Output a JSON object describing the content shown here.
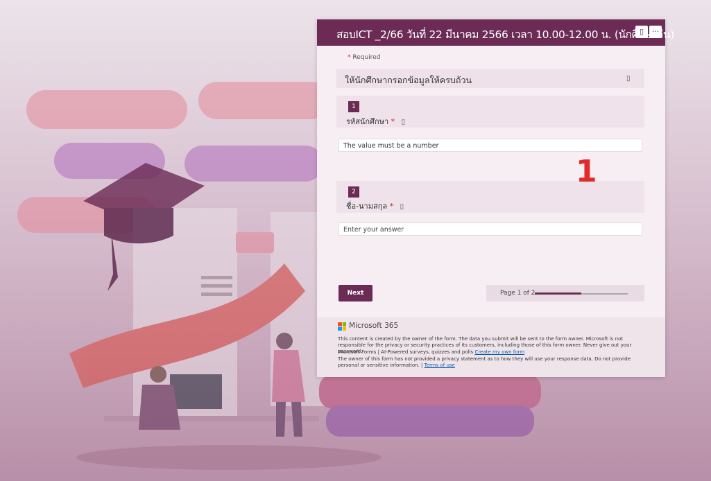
{
  "form": {
    "title": "สอบICT _2/66 วันที่ 22 มีนาคม 2566 เวลา 10.00-12.00 น. (นักศึกษาจีน)",
    "header_reader_label": "▯",
    "header_more_label": "···",
    "required_asterisk": "*",
    "required_label": "Required",
    "section_text": "ให้นักศึกษากรอกข้อมูลให้ครบถ้วน",
    "questions": [
      {
        "number": "1",
        "label": "รหัสนักศึกษา",
        "asterisk": "*",
        "answer": "The value must be a number"
      },
      {
        "number": "2",
        "label": "ชื่อ-นามสกุล",
        "asterisk": "*",
        "placeholder": "Enter your answer"
      }
    ],
    "next_label": "Next",
    "page_text": "Page 1 of 2",
    "page_progress_percent": 50
  },
  "footer": {
    "brand": "Microsoft 365",
    "line1": "This content is created by the owner of the form. The data you submit will be sent to the form owner. Microsoft is not responsible for the privacy or security practices of its customers, including those of this form owner. Never give out your password.",
    "line2_prefix": "Microsoft Forms | AI-Powered surveys, quizzes and polls",
    "line2_link": "Create my own form",
    "line3_prefix": "The owner of this form has not provided a privacy statement as to how they will use your response data. Do not provide personal or sensitive information. |",
    "line3_link": "Terms of use",
    "logo_colors": [
      "#f25022",
      "#7fba00",
      "#00a4ef",
      "#ffb900"
    ]
  },
  "annotation": {
    "label": "1",
    "color": "#e32a2a"
  },
  "colors": {
    "brand": "#6b2b55"
  }
}
